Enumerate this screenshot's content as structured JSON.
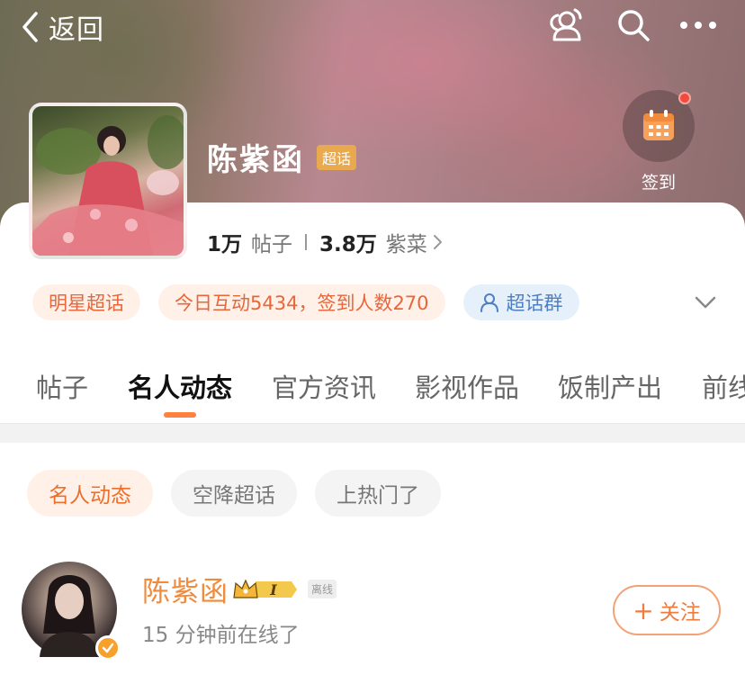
{
  "nav": {
    "back_label": "返回"
  },
  "profile": {
    "name": "陈紫函",
    "tag": "超话",
    "checkin_label": "签到",
    "posts_count": "1万",
    "posts_label": "帖子",
    "fans_count": "3.8万",
    "fans_label": "紫菜"
  },
  "chips": {
    "category": "明星超话",
    "today": "今日互动5434，签到人数270",
    "group": "超话群"
  },
  "tabs": [
    {
      "label": "帖子"
    },
    {
      "label": "名人动态"
    },
    {
      "label": "官方资讯"
    },
    {
      "label": "影视作品"
    },
    {
      "label": "饭制产出"
    },
    {
      "label": "前线"
    }
  ],
  "subtabs": [
    {
      "label": "名人动态"
    },
    {
      "label": "空降超话"
    },
    {
      "label": "上热门了"
    }
  ],
  "user": {
    "name": "陈紫函",
    "level": "I",
    "offline_tag": "离线",
    "status": "15 分钟前在线了",
    "follow_label": "关注",
    "follow_plus": "+"
  },
  "colors": {
    "accent": "#ee7d3d",
    "tab_underline": "#ff8140",
    "tag_gold": "#e9a94f",
    "group_blue": "#4c7fc4",
    "checkin_dot": "#f24a3d"
  },
  "icons": {
    "back": "chevron-left-icon",
    "people": "people-icon",
    "search": "search-icon",
    "more": "more-icon",
    "calendar": "calendar-icon",
    "expand": "chevron-down-icon"
  }
}
